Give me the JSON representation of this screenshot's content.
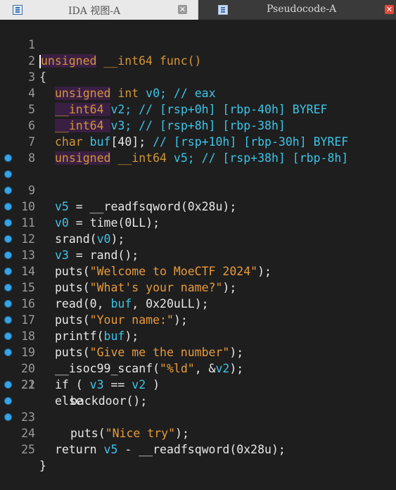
{
  "tabs": [
    {
      "label": "IDA 视图-A",
      "close": "✕"
    },
    {
      "label": "Pseudocode-A",
      "close": "✕"
    }
  ],
  "code_lines": [
    {
      "num": "1",
      "bp": false
    },
    {
      "num": "2",
      "bp": false
    },
    {
      "num": "3",
      "bp": false
    },
    {
      "num": "4",
      "bp": false
    },
    {
      "num": "5",
      "bp": false
    },
    {
      "num": "6",
      "bp": false
    },
    {
      "num": "7",
      "bp": false
    },
    {
      "num": "8",
      "bp": false
    },
    {
      "num": "9",
      "bp": true
    },
    {
      "num": "10",
      "bp": true
    },
    {
      "num": "11",
      "bp": true
    },
    {
      "num": "12",
      "bp": true
    },
    {
      "num": "13",
      "bp": true
    },
    {
      "num": "14",
      "bp": true
    },
    {
      "num": "15",
      "bp": true
    },
    {
      "num": "16",
      "bp": true
    },
    {
      "num": "17",
      "bp": true
    },
    {
      "num": "18",
      "bp": true
    },
    {
      "num": "19",
      "bp": true
    },
    {
      "num": "20",
      "bp": true
    },
    {
      "num": "21",
      "bp": true
    },
    {
      "num": "22",
      "bp": false
    },
    {
      "num": "23",
      "bp": true
    },
    {
      "num": "24",
      "bp": true
    },
    {
      "num": "25",
      "bp": true
    }
  ],
  "tokens": {
    "l1": [
      "unsigned",
      " __int64 func()"
    ],
    "l2": [
      "{"
    ],
    "l3": [
      "unsigned",
      " int ",
      "v0",
      "; // eax"
    ],
    "l4": [
      "__int64 ",
      "v2",
      "; // [rsp+0h] [rbp-40h] BYREF"
    ],
    "l5": [
      "__int64 ",
      "v3",
      "; // [rsp+8h] [rbp-38h]"
    ],
    "l6": [
      "char ",
      "buf",
      "[40]; ",
      "// [rsp+10h] [rbp-30h] BYREF"
    ],
    "l7": [
      "unsigned",
      " __int64 ",
      "v5",
      "; // [rsp+38h] [rbp-8h]"
    ],
    "l9": [
      "v5",
      " = __readfsqword(0x28u);"
    ],
    "l10": [
      "v0",
      " = time(0LL);"
    ],
    "l11": [
      "srand(",
      "v0",
      ");"
    ],
    "l12": [
      "v3",
      " = rand();"
    ],
    "l13": [
      "puts(",
      "\"Welcome to MoeCTF 2024\"",
      ");"
    ],
    "l14": [
      "puts(",
      "\"What's your name?\"",
      ");"
    ],
    "l15": [
      "read(0, ",
      "buf",
      ", 0x20uLL);"
    ],
    "l16": [
      "puts(",
      "\"Your name:\"",
      ");"
    ],
    "l17": [
      "printf(",
      "buf",
      ");"
    ],
    "l18": [
      "puts(",
      "\"Give me the number\"",
      ");"
    ],
    "l19": [
      "__isoc99_scanf(",
      "\"%ld\"",
      ", &",
      "v2",
      ");"
    ],
    "l20": [
      "if ( ",
      "v3",
      " == ",
      "v2",
      " )"
    ],
    "l21": [
      "backdoor();"
    ],
    "l22": [
      "else"
    ],
    "l23": [
      "puts(",
      "\"Nice try\"",
      ");"
    ],
    "l24": [
      "return ",
      "v5",
      " - __readfsqword(0x28u);"
    ],
    "l25": [
      "}"
    ]
  }
}
